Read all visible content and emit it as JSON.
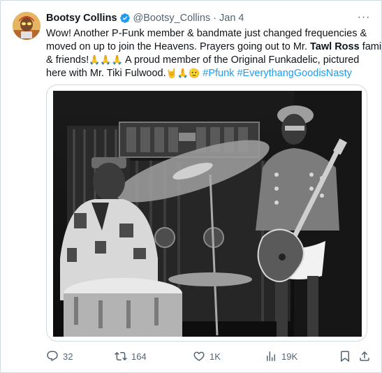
{
  "tweet": {
    "author_name": "Bootsy Collins",
    "handle": "@Bootsy_Collins",
    "separator": "·",
    "date": "Jan 4",
    "more_label": "···",
    "text_line1": "Wow! Another P-Funk member & bandmate just changed frequencies &",
    "text_line2": "moved on up to join the Heavens. Prayers going out to Mr. ",
    "mention_name": "Tawl Ross",
    "text_line2_end": " family",
    "text_line3_start": "& friends!",
    "text_line3_end": " A proud member of the Original Funkadelic, pictured",
    "text_line4": "here with Mr. Tiki Fulwood.",
    "hashtag_1": "#Pfunk",
    "hashtag_2": "#EverythangGoodisNasty",
    "emoji_pray": "🙏🙏🙏",
    "emoji_tail": "🤘🙏🫡"
  },
  "actions": {
    "replies": "32",
    "retweets": "164",
    "likes": "1K",
    "views": "19K"
  },
  "icons": {
    "verified": "verified-badge-icon",
    "reply": "reply-icon",
    "retweet": "retweet-icon",
    "like": "heart-icon",
    "views": "views-icon",
    "bookmark": "bookmark-icon",
    "share": "share-icon"
  },
  "colors": {
    "text": "#0f1419",
    "secondary": "#536471",
    "accent": "#1d9bf0",
    "border": "#cfd9de"
  }
}
